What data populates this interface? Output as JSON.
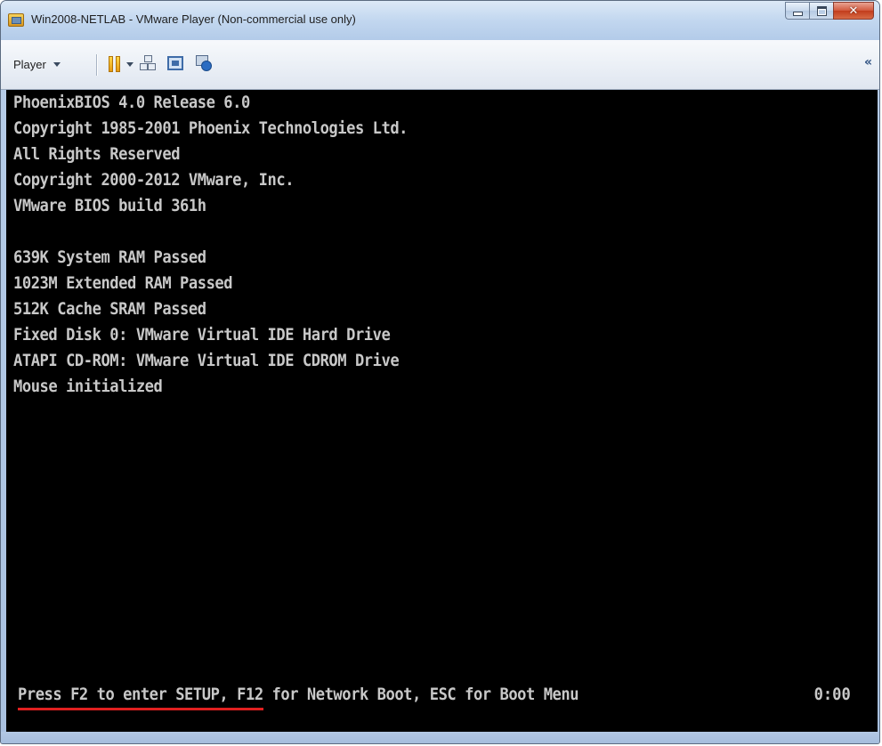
{
  "window": {
    "title": "Win2008-NETLAB - VMware Player (Non-commercial use only)",
    "minimize_label": "",
    "maximize_label": "",
    "close_label": "✕"
  },
  "toolbar": {
    "player_menu_label": "Player",
    "collapse_label": "«"
  },
  "console": {
    "lines": [
      "PhoenixBIOS 4.0 Release 6.0",
      "Copyright 1985-2001 Phoenix Technologies Ltd.",
      "All Rights Reserved",
      "Copyright 2000-2012 VMware, Inc.",
      "VMware BIOS build 361h",
      "",
      "639K System RAM Passed",
      "1023M Extended RAM Passed",
      "512K Cache SRAM Passed",
      "Fixed Disk 0: VMware Virtual IDE Hard Drive",
      "ATAPI CD-ROM: VMware Virtual IDE CDROM Drive",
      "Mouse initialized"
    ],
    "boot_prompt": "Press F2 to enter SETUP, F12 for Network Boot, ESC for Boot Menu",
    "timer": "0:00",
    "colors": {
      "background": "#000000",
      "text": "#c8c8c8",
      "underline": "#e02020"
    }
  }
}
